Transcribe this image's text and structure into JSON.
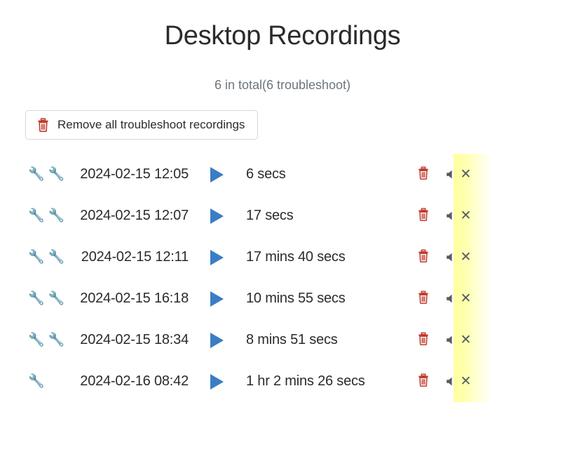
{
  "header": {
    "title": "Desktop Recordings",
    "subtitle": "6 in total(6 troubleshoot)"
  },
  "toolbar": {
    "remove_all_label": "Remove all troubleshoot recordings",
    "remove_all_icon": "trash-icon"
  },
  "icons": {
    "wrench": "🔧",
    "play": "play-icon",
    "trash": "trash-icon",
    "speaker": "speaker-muted-icon",
    "x_mark": "✕"
  },
  "colors": {
    "title": "#2b2b2b",
    "subtitle": "#6c757d",
    "play_blue": "#3b7dc4",
    "trash_red": "#c0392b",
    "highlight_yellow": "#ffff9e",
    "icon_gray": "#555b5e",
    "button_border": "#d8d8d8"
  },
  "recordings": [
    {
      "troubleshoot_flags": 2,
      "date": "2024-02-15 12:05",
      "duration": "6 secs"
    },
    {
      "troubleshoot_flags": 2,
      "date": "2024-02-15 12:07",
      "duration": "17 secs"
    },
    {
      "troubleshoot_flags": 2,
      "date": "2024-02-15 12:11",
      "duration": "17 mins 40 secs"
    },
    {
      "troubleshoot_flags": 2,
      "date": "2024-02-15 16:18",
      "duration": "10 mins 55 secs"
    },
    {
      "troubleshoot_flags": 2,
      "date": "2024-02-15 18:34",
      "duration": "8 mins 51 secs"
    },
    {
      "troubleshoot_flags": 1,
      "date": "2024-02-16 08:42",
      "duration": "1 hr 2 mins 26 secs"
    }
  ]
}
